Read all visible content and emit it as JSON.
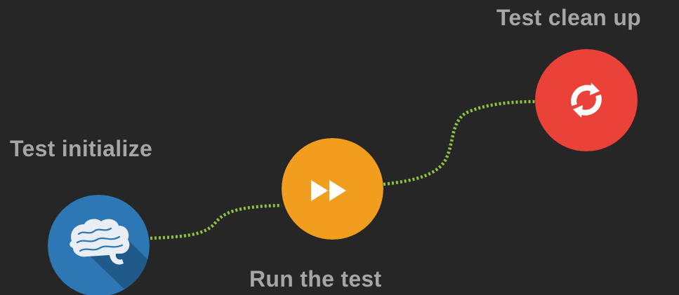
{
  "steps": [
    {
      "id": "init",
      "label": "Test initialize",
      "icon": "brain-icon",
      "color": "#2e77b5"
    },
    {
      "id": "run",
      "label": "Run the test",
      "icon": "fast-forward-icon",
      "color": "#f29d1e"
    },
    {
      "id": "clean",
      "label": "Test clean up",
      "icon": "refresh-icon",
      "color": "#ea4139"
    }
  ],
  "connector_color": "#8cc43f",
  "background": "#262626",
  "label_color": "#a6a6a6"
}
